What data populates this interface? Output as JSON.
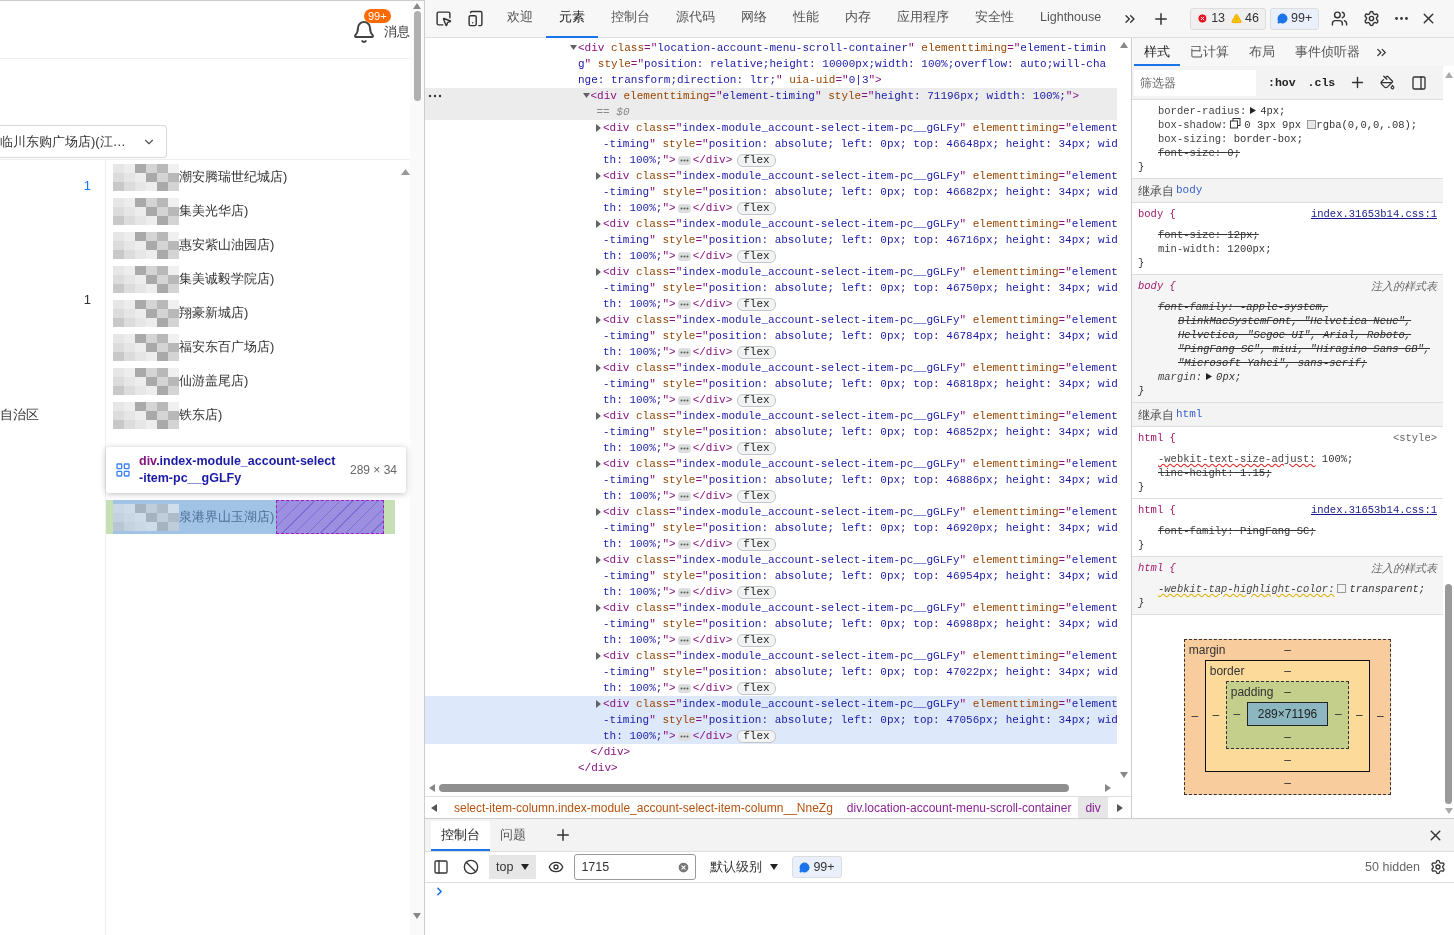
{
  "page": {
    "notification": {
      "badge": "99+",
      "label": "消息"
    },
    "store_select": {
      "value": "临川东购广场店)(江…"
    },
    "side_texts": [
      {
        "text": "1",
        "kind": "link"
      },
      {
        "text": "1",
        "kind": "count"
      },
      {
        "text": "自治区",
        "kind": "region"
      }
    ],
    "store_options": [
      {
        "text": "潮安腾瑞世纪城店)",
        "highlighted": false
      },
      {
        "text": "集美光华店)",
        "highlighted": false
      },
      {
        "text": "惠安紫山油园店)",
        "highlighted": false
      },
      {
        "text": "集美诚毅学院店)",
        "highlighted": false
      },
      {
        "text": "翔豪新城店)",
        "highlighted": false
      },
      {
        "text": "福安东百广场店)",
        "highlighted": false
      },
      {
        "text": "仙游盖尾店)",
        "highlighted": false
      },
      {
        "text": "铁东店)",
        "highlighted": false
      },
      {
        "text": "泉港界山玉湖店)",
        "highlighted": true
      }
    ],
    "inspect_tooltip": {
      "tag": "div",
      "classes": ".index-module_account-select-item-pc__gGLFy",
      "size": "289 × 34"
    }
  },
  "devtools": {
    "tabs": [
      {
        "label": "欢迎",
        "selected": false
      },
      {
        "label": "元素",
        "selected": true
      },
      {
        "label": "控制台",
        "selected": false
      },
      {
        "label": "源代码",
        "selected": false
      },
      {
        "label": "网络",
        "selected": false
      },
      {
        "label": "性能",
        "selected": false
      },
      {
        "label": "内存",
        "selected": false
      },
      {
        "label": "应用程序",
        "selected": false
      },
      {
        "label": "安全性",
        "selected": false
      },
      {
        "label": "Lighthouse",
        "selected": false
      }
    ],
    "counters": [
      {
        "kind": "error",
        "count": "13"
      },
      {
        "kind": "warning",
        "count": "46"
      },
      {
        "kind": "info",
        "count": "99+"
      }
    ],
    "dom_tree": [
      {
        "open": "<div class=\"location-account-menu-scroll-container\" elementtiming=\"element-timing\" style=\"position: relative;height: 10000px;width: 100%;overflow: auto;will-change: transform;direction: ltr;\" uia-uid=\"0|3\">",
        "close": "</div>",
        "expanded": true,
        "selected": false,
        "hovered": false,
        "children": [
          {
            "open": "<div elementtiming=\"element-timing\" style=\"height: 71196px; width: 100%;\">",
            "close": "</div>",
            "marker": "== $0",
            "expanded": true,
            "selected": true,
            "hovered": false,
            "children": [
              {
                "open": "<div class=\"index-module_account-select-item-pc__gGLFy\" elementtiming=\"element-timing\" style=\"position: absolute; left: 0px; top: 46648px; height: 34px; width: 100%;\">",
                "close": "</div>",
                "badge": "flex",
                "expanded": false,
                "selected": false,
                "hovered": false
              },
              {
                "open": "<div class=\"index-module_account-select-item-pc__gGLFy\" elementtiming=\"element-timing\" style=\"position: absolute; left: 0px; top: 46682px; height: 34px; width: 100%;\">",
                "close": "</div>",
                "badge": "flex",
                "expanded": false,
                "selected": false,
                "hovered": false
              },
              {
                "open": "<div class=\"index-module_account-select-item-pc__gGLFy\" elementtiming=\"element-timing\" style=\"position: absolute; left: 0px; top: 46716px; height: 34px; width: 100%;\">",
                "close": "</div>",
                "badge": "flex",
                "expanded": false,
                "selected": false,
                "hovered": false
              },
              {
                "open": "<div class=\"index-module_account-select-item-pc__gGLFy\" elementtiming=\"element-timing\" style=\"position: absolute; left: 0px; top: 46750px; height: 34px; width: 100%;\">",
                "close": "</div>",
                "badge": "flex",
                "expanded": false,
                "selected": false,
                "hovered": false
              },
              {
                "open": "<div class=\"index-module_account-select-item-pc__gGLFy\" elementtiming=\"element-timing\" style=\"position: absolute; left: 0px; top: 46784px; height: 34px; width: 100%;\">",
                "close": "</div>",
                "badge": "flex",
                "expanded": false,
                "selected": false,
                "hovered": false
              },
              {
                "open": "<div class=\"index-module_account-select-item-pc__gGLFy\" elementtiming=\"element-timing\" style=\"position: absolute; left: 0px; top: 46818px; height: 34px; width: 100%;\">",
                "close": "</div>",
                "badge": "flex",
                "expanded": false,
                "selected": false,
                "hovered": false
              },
              {
                "open": "<div class=\"index-module_account-select-item-pc__gGLFy\" elementtiming=\"element-timing\" style=\"position: absolute; left: 0px; top: 46852px; height: 34px; width: 100%;\">",
                "close": "</div>",
                "badge": "flex",
                "expanded": false,
                "selected": false,
                "hovered": false
              },
              {
                "open": "<div class=\"index-module_account-select-item-pc__gGLFy\" elementtiming=\"element-timing\" style=\"position: absolute; left: 0px; top: 46886px; height: 34px; width: 100%;\">",
                "close": "</div>",
                "badge": "flex",
                "expanded": false,
                "selected": false,
                "hovered": false
              },
              {
                "open": "<div class=\"index-module_account-select-item-pc__gGLFy\" elementtiming=\"element-timing\" style=\"position: absolute; left: 0px; top: 46920px; height: 34px; width: 100%;\">",
                "close": "</div>",
                "badge": "flex",
                "expanded": false,
                "selected": false,
                "hovered": false
              },
              {
                "open": "<div class=\"index-module_account-select-item-pc__gGLFy\" elementtiming=\"element-timing\" style=\"position: absolute; left: 0px; top: 46954px; height: 34px; width: 100%;\">",
                "close": "</div>",
                "badge": "flex",
                "expanded": false,
                "selected": false,
                "hovered": false
              },
              {
                "open": "<div class=\"index-module_account-select-item-pc__gGLFy\" elementtiming=\"element-timing\" style=\"position: absolute; left: 0px; top: 46988px; height: 34px; width: 100%;\">",
                "close": "</div>",
                "badge": "flex",
                "expanded": false,
                "selected": false,
                "hovered": false
              },
              {
                "open": "<div class=\"index-module_account-select-item-pc__gGLFy\" elementtiming=\"element-timing\" style=\"position: absolute; left: 0px; top: 47022px; height: 34px; width: 100%;\">",
                "close": "</div>",
                "badge": "flex",
                "expanded": false,
                "selected": false,
                "hovered": false
              },
              {
                "open": "<div class=\"index-module_account-select-item-pc__gGLFy\" elementtiming=\"element-timing\" style=\"position: absolute; left: 0px; top: 47056px; height: 34px; width: 100%;\">",
                "close": "</div>",
                "badge": "flex",
                "expanded": false,
                "selected": false,
                "hovered": true
              }
            ]
          }
        ]
      }
    ],
    "breadcrumbs": [
      {
        "text": "select-item-column.index-module_account-select-item-column__NneZg",
        "kind": "class",
        "selected": false
      },
      {
        "text": "div.location-account-menu-scroll-container",
        "kind": "element",
        "selected": false
      },
      {
        "text": "div",
        "kind": "element",
        "selected": true
      }
    ],
    "styles": {
      "tabs": [
        {
          "label": "样式",
          "selected": true
        },
        {
          "label": "已计算",
          "selected": false
        },
        {
          "label": "布局",
          "selected": false
        },
        {
          "label": "事件侦听器",
          "selected": false
        }
      ],
      "filter_placeholder": "筛选器",
      "buttons": [
        ":hov",
        ".cls"
      ],
      "sections": [
        {
          "kind": "rule",
          "declarations": [
            {
              "text": "border-radius: 4px;",
              "kind": "expand",
              "struck": false
            },
            {
              "text": "box-shadow: 0 3px 9px rgba(0,0,0,.08);",
              "kind": "shadow",
              "struck": false
            },
            {
              "text": "box-sizing: border-box;",
              "kind": "plain",
              "struck": false
            },
            {
              "text": "font-size: 0;",
              "kind": "plain",
              "struck": true
            }
          ],
          "close": "}"
        },
        {
          "kind": "inherited",
          "label": "继承自",
          "element": "body"
        },
        {
          "kind": "rule",
          "selector": "body {",
          "source": "index.31653b14.css:1",
          "linked": true,
          "declarations": [
            {
              "text": "font-size: 12px;",
              "kind": "plain",
              "struck": true
            },
            {
              "text": "min-width: 1200px;",
              "kind": "plain",
              "struck": false
            }
          ],
          "close": "}"
        },
        {
          "kind": "injected",
          "selector": "body {",
          "source": "注入的样式表",
          "linked": false,
          "declarations": [
            {
              "text": "font-family: -apple-system, BlinkMacSystemFont, \"Helvetica Neue\", Helvetica, \"Segoe UI\", Arial, Roboto, \"PingFang SC\", miui, \"Hiragino Sans GB\", \"Microsoft Yahei\", sans-serif;",
              "kind": "plain",
              "struck": true
            },
            {
              "text": "margin: 0px;",
              "kind": "expand",
              "struck": false
            }
          ],
          "close": "}"
        },
        {
          "kind": "inherited",
          "label": "继承自",
          "element": "html"
        },
        {
          "kind": "rule",
          "selector": "html {",
          "source": "<style>",
          "linked": false,
          "declarations": [
            {
              "text": "-webkit-text-size-adjust: 100%;",
              "kind": "plain",
              "struck": false,
              "invalid": true
            },
            {
              "text": "line-height: 1.15;",
              "kind": "plain",
              "struck": true
            }
          ],
          "close": "}"
        },
        {
          "kind": "rule",
          "selector": "html {",
          "source": "index.31653b14.css:1",
          "linked": true,
          "declarations": [
            {
              "text": "font-family: PingFang SC;",
              "kind": "plain",
              "struck": true
            }
          ],
          "close": "}"
        },
        {
          "kind": "injected",
          "selector": "html {",
          "source": "注入的样式表",
          "linked": false,
          "declarations": [
            {
              "text": "-webkit-tap-highlight-color: transparent;",
              "kind": "color",
              "struck": false,
              "unsupported": true
            }
          ],
          "close": "}"
        }
      ],
      "box_model": {
        "margin": {
          "label": "margin",
          "top": "–",
          "right": "–",
          "bottom": "–",
          "left": "–"
        },
        "border": {
          "label": "border",
          "top": "–",
          "right": "–",
          "bottom": "–",
          "left": "–"
        },
        "padding": {
          "label": "padding",
          "top": "–",
          "right": "–",
          "bottom": "–",
          "left": "–"
        },
        "content": "289×71196"
      }
    },
    "drawer": {
      "tabs": [
        {
          "label": "控制台",
          "selected": true
        },
        {
          "label": "问题",
          "selected": false
        }
      ],
      "context": "top",
      "filter_value": "1715",
      "level": "默认级别",
      "message_count": "99+",
      "hidden": "50 hidden"
    }
  }
}
